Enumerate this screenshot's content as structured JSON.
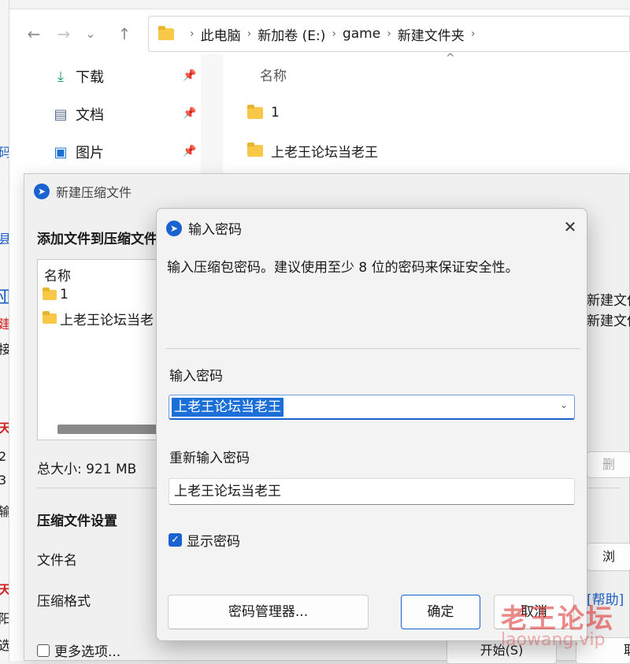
{
  "explorer": {
    "nav": {
      "back": "←",
      "forward": "→",
      "recent": "⌄",
      "up": "↑"
    },
    "breadcrumb": [
      "此电脑",
      "新加卷 (E:)",
      "game",
      "新建文件夹"
    ],
    "sidebar": [
      {
        "label": "下载",
        "icon": "download-icon"
      },
      {
        "label": "文档",
        "icon": "document-icon"
      },
      {
        "label": "图片",
        "icon": "picture-icon"
      }
    ],
    "column_header": "名称",
    "files": [
      "1",
      "上老王论坛当老王"
    ]
  },
  "compress_window": {
    "title": "新建压缩文件",
    "heading": "添加文件到压缩文件",
    "list_header": "名称",
    "list_items": [
      "1",
      "上老王论坛当老"
    ],
    "total_size": "总大小: 921 MB",
    "settings_title": "压缩文件设置",
    "filename_label": "文件名",
    "format_label": "压缩格式",
    "more_options": "更多选项...",
    "right_text_1": "新建文件",
    "right_text_2": "新建文件",
    "delete_btn": "删",
    "browse_btn": "浏",
    "help_link": "[帮助]",
    "start_btn": "开始(S)",
    "cancel_btn": "取"
  },
  "password_dialog": {
    "title": "输入密码",
    "description": "输入压缩包密码。建议使用至少 8 位的密码来保证安全性。",
    "password_label": "输入密码",
    "password_value": "上老王论坛当老王",
    "reenter_label": "重新输入密码",
    "reenter_value": "上老王论坛当老王",
    "show_password_label": "显示密码",
    "show_password_checked": true,
    "manager_button": "密码管理器...",
    "ok_button": "确定",
    "cancel_button": "取消"
  },
  "watermark": {
    "main": "老王论坛",
    "sub": "laowang.vip"
  },
  "colors": {
    "accent": "#1b62d1",
    "selection": "#1d6fd8",
    "folder": "#f8c948"
  }
}
